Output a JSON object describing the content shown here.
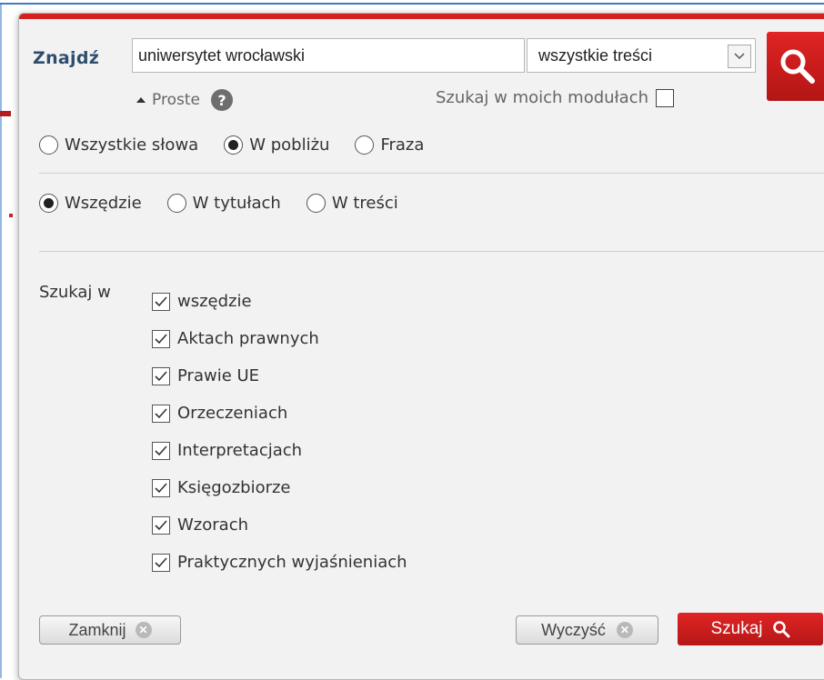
{
  "search": {
    "label": "Znajdź",
    "query": "uniwersytet wrocławski",
    "scope_selected": "wszystkie treści",
    "simple_label": "Proste",
    "my_modules_label": "Szukaj w moich modułach",
    "my_modules_checked": false
  },
  "match_mode": {
    "options": [
      {
        "label": "Wszystkie słowa",
        "checked": false
      },
      {
        "label": "W pobliżu",
        "checked": true
      },
      {
        "label": "Fraza",
        "checked": false
      }
    ]
  },
  "location": {
    "options": [
      {
        "label": "Wszędzie",
        "checked": true
      },
      {
        "label": "W tytułach",
        "checked": false
      },
      {
        "label": "W treści",
        "checked": false
      }
    ]
  },
  "search_in": {
    "label": "Szukaj w",
    "items": [
      {
        "label": "wszędzie",
        "checked": true
      },
      {
        "label": "Aktach prawnych",
        "checked": true
      },
      {
        "label": "Prawie UE",
        "checked": true
      },
      {
        "label": "Orzeczeniach",
        "checked": true
      },
      {
        "label": "Interpretacjach",
        "checked": true
      },
      {
        "label": "Księgozbiorze",
        "checked": true
      },
      {
        "label": "Wzorach",
        "checked": true
      },
      {
        "label": "Praktycznych wyjaśnieniach",
        "checked": true
      }
    ]
  },
  "buttons": {
    "close_label": "Zamknij",
    "clear_label": "Wyczyść",
    "search_label": "Szukaj"
  },
  "colors": {
    "accent_red": "#d61f1f",
    "label_blue": "#2f4d6e"
  }
}
